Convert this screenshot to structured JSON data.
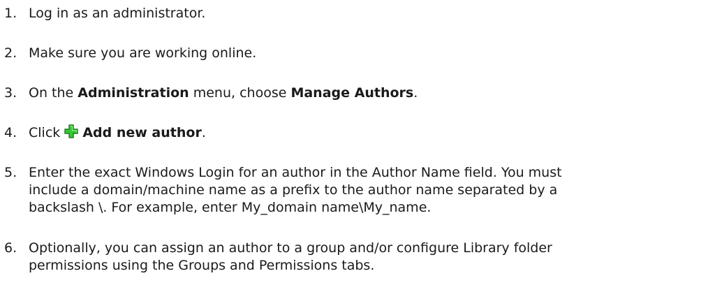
{
  "steps": [
    {
      "number": "1.",
      "text": "Log in as an administrator."
    },
    {
      "number": "2.",
      "text": "Make sure you are working online."
    },
    {
      "number": "3.",
      "prefix": "On the ",
      "menu": "Administration",
      "middle": " menu, choose ",
      "command": "Manage Authors",
      "suffix": "."
    },
    {
      "number": "4.",
      "prefix": "Click ",
      "icon": "add-plus-icon",
      "command": "Add new author",
      "suffix": "."
    },
    {
      "number": "5.",
      "lines": [
        "Enter the exact Windows Login for an author in the Author Name field. You must",
        "include a domain/machine name as a prefix to the author name separated by a",
        "backslash \\. For example, enter My_domain name\\My_name."
      ]
    },
    {
      "number": "6.",
      "lines": [
        "Optionally, you can assign an author to a group and/or configure Library folder",
        "permissions using the Groups and Permissions tabs."
      ]
    }
  ],
  "colors": {
    "text": "#1a1a1a",
    "icon_fill": "#33cc33",
    "icon_outline": "#1f7a1f"
  }
}
